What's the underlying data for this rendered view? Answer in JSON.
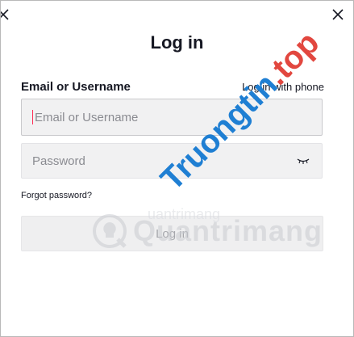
{
  "modal": {
    "title": "Log in",
    "username_label": "Email or Username",
    "phone_link": "Log in with phone",
    "username_placeholder": "Email or Username",
    "password_placeholder": "Password",
    "forgot_link": "Forgot password?",
    "login_button": "Log in"
  },
  "watermarks": {
    "main_part1": "Truongtin",
    "main_part2": ".top",
    "secondary": "Quantrimang",
    "secondary_small": "uantrimang"
  },
  "colors": {
    "accent": "#fe2c55",
    "watermark_blue": "#1f7fd3",
    "watermark_red": "#e2473f"
  }
}
